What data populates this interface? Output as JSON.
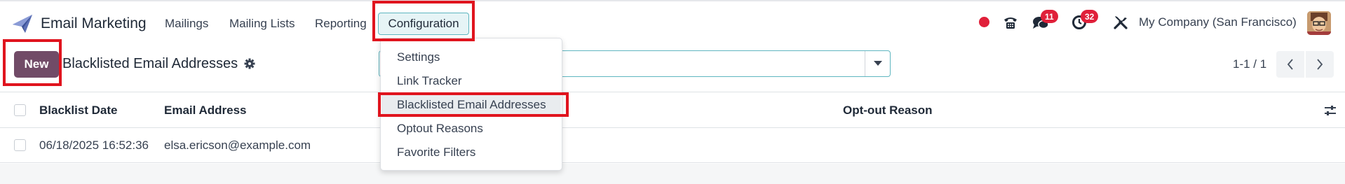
{
  "app": {
    "name": "Email Marketing",
    "accent_color": "#714b67",
    "highlight_color": "#e0141e"
  },
  "menu": {
    "items": [
      "Mailings",
      "Mailing Lists",
      "Reporting"
    ],
    "configuration": "Configuration"
  },
  "systray": {
    "messages_count": "11",
    "activities_count": "32",
    "company": "My Company (San Francisco)",
    "icons": [
      "record-dot-icon",
      "phone-icon",
      "chat-icon",
      "clock-icon",
      "tools-icon"
    ]
  },
  "control": {
    "new_label": "New",
    "title": "Blacklisted Email Addresses",
    "pager": "1-1 / 1"
  },
  "list": {
    "columns": [
      "Blacklist Date",
      "Email Address",
      "Opt-out Reason"
    ],
    "rows": [
      {
        "date": "06/18/2025 16:52:36",
        "email": "elsa.ericson@example.com",
        "reason": ""
      }
    ]
  },
  "dropdown": {
    "items": [
      "Settings",
      "Link Tracker",
      "Blacklisted Email Addresses",
      "Optout Reasons",
      "Favorite Filters"
    ],
    "active_index": 2
  }
}
